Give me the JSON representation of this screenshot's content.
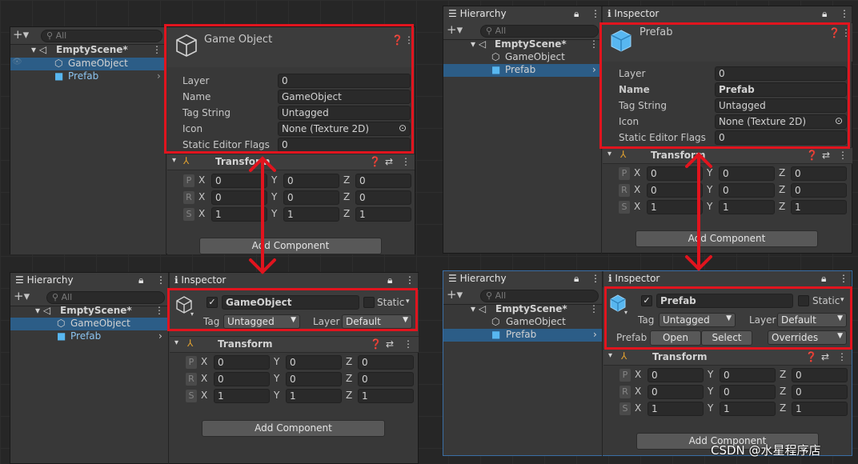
{
  "tl": {
    "search": "All",
    "scene": "EmptyScene*",
    "items": [
      "GameObject",
      "Prefab"
    ],
    "title": "Game Object",
    "layer_lbl": "Layer",
    "layer_val": "0",
    "name_lbl": "Name",
    "name_val": "GameObject",
    "tag_lbl": "Tag String",
    "tag_val": "Untagged",
    "icon_lbl": "Icon",
    "icon_val": "None (Texture 2D)",
    "sef_lbl": "Static Editor Flags",
    "sef_val": "0",
    "transform": "Transform",
    "rows": [
      [
        "P",
        "X",
        "0",
        "Y",
        "0",
        "Z",
        "0"
      ],
      [
        "R",
        "X",
        "0",
        "Y",
        "0",
        "Z",
        "0"
      ],
      [
        "S",
        "X",
        "1",
        "Y",
        "1",
        "Z",
        "1"
      ]
    ],
    "add": "Add Component"
  },
  "tr": {
    "hier_tab": "Hierarchy",
    "insp_tab": "Inspector",
    "search": "All",
    "scene": "EmptyScene*",
    "items": [
      "GameObject",
      "Prefab"
    ],
    "title": "Prefab",
    "layer_lbl": "Layer",
    "layer_val": "0",
    "name_lbl": "Name",
    "name_val": "Prefab",
    "tag_lbl": "Tag String",
    "tag_val": "Untagged",
    "icon_lbl": "Icon",
    "icon_val": "None (Texture 2D)",
    "sef_lbl": "Static Editor Flags",
    "sef_val": "0",
    "transform": "Transform",
    "rows": [
      [
        "P",
        "X",
        "0",
        "Y",
        "0",
        "Z",
        "0"
      ],
      [
        "R",
        "X",
        "0",
        "Y",
        "0",
        "Z",
        "0"
      ],
      [
        "S",
        "X",
        "1",
        "Y",
        "1",
        "Z",
        "1"
      ]
    ],
    "add": "Add Component"
  },
  "bl": {
    "hier_tab": "Hierarchy",
    "insp_tab": "Inspector",
    "search": "All",
    "scene": "EmptyScene*",
    "items": [
      "GameObject",
      "Prefab"
    ],
    "obj_name": "GameObject",
    "static": "Static",
    "tag_lbl": "Tag",
    "tag_val": "Untagged",
    "layer_lbl": "Layer",
    "layer_val": "Default",
    "transform": "Transform",
    "rows": [
      [
        "P",
        "X",
        "0",
        "Y",
        "0",
        "Z",
        "0"
      ],
      [
        "R",
        "X",
        "0",
        "Y",
        "0",
        "Z",
        "0"
      ],
      [
        "S",
        "X",
        "1",
        "Y",
        "1",
        "Z",
        "1"
      ]
    ],
    "add": "Add Component"
  },
  "br": {
    "hier_tab": "Hierarchy",
    "insp_tab": "Inspector",
    "search": "All",
    "scene": "EmptyScene*",
    "items": [
      "GameObject",
      "Prefab"
    ],
    "obj_name": "Prefab",
    "static": "Static",
    "tag_lbl": "Tag",
    "tag_val": "Untagged",
    "layer_lbl": "Layer",
    "layer_val": "Default",
    "prefab_lbl": "Prefab",
    "open": "Open",
    "select": "Select",
    "overrides": "Overrides",
    "transform": "Transform",
    "rows": [
      [
        "P",
        "X",
        "0",
        "Y",
        "0",
        "Z",
        "0"
      ],
      [
        "R",
        "X",
        "0",
        "Y",
        "0",
        "Z",
        "0"
      ],
      [
        "S",
        "X",
        "1",
        "Y",
        "1",
        "Z",
        "1"
      ]
    ],
    "add": "Add Component"
  },
  "watermark": "CSDN @水星程序店",
  "colors": {
    "highlight": "#e1141e",
    "selection": "#2c5d87",
    "prefab_blue": "#58b7f0"
  }
}
